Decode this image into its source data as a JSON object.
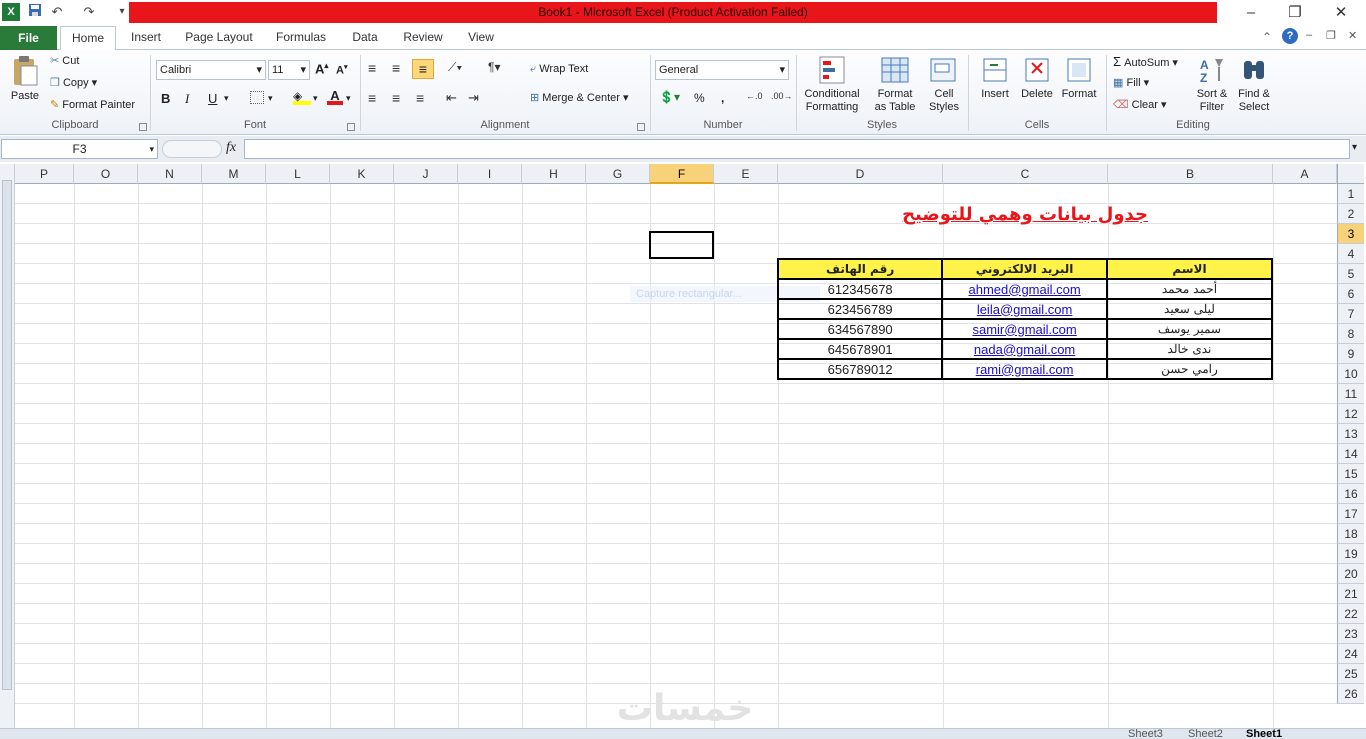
{
  "window": {
    "title": "Book1  -  Microsoft Excel (Product Activation Failed)",
    "minimize": "–",
    "restore": "❐",
    "close": "✕"
  },
  "qat": {
    "app_icon": "excel-icon",
    "save": "save-icon",
    "undo": "↶",
    "redo": "↷",
    "more": "▾"
  },
  "tabs": [
    "File",
    "Home",
    "Insert",
    "Page Layout",
    "Formulas",
    "Data",
    "Review",
    "View"
  ],
  "ribbon": {
    "clipboard": {
      "label": "Clipboard",
      "paste": "Paste",
      "cut": "Cut",
      "copy": "Copy",
      "format_painter": "Format Painter"
    },
    "font": {
      "label": "Font",
      "name": "Calibri",
      "size": "11",
      "bold": "B",
      "italic": "I",
      "underline": "U"
    },
    "alignment": {
      "label": "Alignment",
      "wrap_text": "Wrap Text",
      "merge_center": "Merge & Center"
    },
    "number": {
      "label": "Number",
      "format": "General",
      "percent": "%",
      "comma": ","
    },
    "styles": {
      "label": "Styles",
      "conditional_1": "Conditional",
      "conditional_2": "Formatting",
      "format_table_1": "Format",
      "format_table_2": "as Table",
      "cell_styles_1": "Cell",
      "cell_styles_2": "Styles"
    },
    "cells": {
      "label": "Cells",
      "insert": "Insert",
      "delete": "Delete",
      "format": "Format"
    },
    "editing": {
      "label": "Editing",
      "autosum": "AutoSum",
      "fill": "Fill",
      "clear": "Clear",
      "sort_1": "Sort &",
      "sort_2": "Filter",
      "find_1": "Find &",
      "find_2": "Select"
    }
  },
  "formula_bar": {
    "name_box": "F3",
    "fx": "fx",
    "content": ""
  },
  "columns": [
    "P",
    "O",
    "N",
    "M",
    "L",
    "K",
    "J",
    "I",
    "H",
    "G",
    "F",
    "E",
    "D",
    "C",
    "B",
    "A"
  ],
  "selected_column": "F",
  "rows": [
    "1",
    "2",
    "3",
    "4",
    "5",
    "6",
    "7",
    "8",
    "9",
    "10",
    "11",
    "12",
    "13",
    "14",
    "15",
    "16",
    "17",
    "18",
    "19",
    "20",
    "21",
    "22",
    "23",
    "24",
    "25",
    "26"
  ],
  "selected_row": "3",
  "sheet": {
    "title": "جدول بيانات وهمي للتوضيح",
    "headers": {
      "name": "الاسم",
      "email": "البريد الالكتروني",
      "phone": "رقم الهاتف"
    },
    "records": [
      {
        "name": "أحمد محمد",
        "email": "ahmed@gmail.com",
        "phone": "612345678"
      },
      {
        "name": "ليلى سعيد",
        "email": "leila@gmail.com",
        "phone": "623456789"
      },
      {
        "name": "سمير يوسف",
        "email": "samir@gmail.com",
        "phone": "634567890"
      },
      {
        "name": "ندى خالد",
        "email": "nada@gmail.com",
        "phone": "645678901"
      },
      {
        "name": "رامي حسن",
        "email": "rami@gmail.com",
        "phone": "656789012"
      }
    ]
  },
  "overlay": {
    "capture": "Capture rectangular..."
  },
  "watermark": "خمسات",
  "sheet_tabs": [
    "Sheet3",
    "Sheet2",
    "Sheet1"
  ],
  "active_sheet": "Sheet1",
  "colors": {
    "title_bar": "#e8161a",
    "file_tab": "#2a7a3a",
    "header_fill": "#fff34a",
    "link": "#1a0dcc",
    "selected_header": "#f7d27a"
  }
}
